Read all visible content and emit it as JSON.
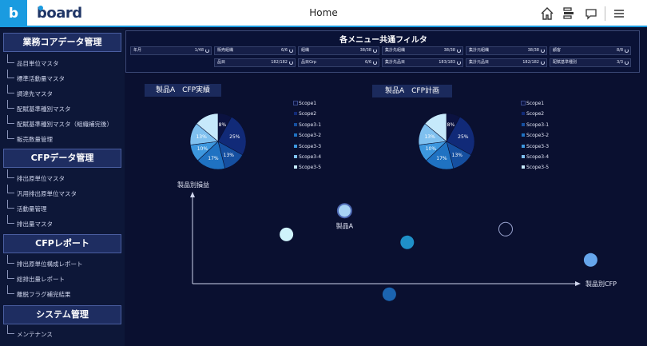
{
  "app": {
    "logo_letter": "b",
    "logo_text": "board",
    "page_title": "Home"
  },
  "toolbar": {
    "icons": [
      "home-icon",
      "layout-icon",
      "chat-icon",
      "menu-icon"
    ]
  },
  "sidebar": {
    "sections": [
      {
        "title": "業務コアデータ管理",
        "items": [
          "品目単位マスタ",
          "標準活動量マスタ",
          "調達先マスタ",
          "配賦基準種別マスタ",
          "配賦基準種別マスタ（組織補完後）",
          "販売数量管理"
        ]
      },
      {
        "title": "CFPデータ管理",
        "items": [
          "排出原単位マスタ",
          "汎用排出原単位マスタ",
          "活動量管理",
          "排出量マスタ"
        ]
      },
      {
        "title": "CFPレポート",
        "items": [
          "排出原単位構成レポート",
          "総排出量レポート",
          "離脱フラグ補完結果"
        ]
      },
      {
        "title": "システム管理",
        "items": [
          "メンテナンス"
        ]
      }
    ]
  },
  "filters": {
    "title": "各メニュー共通フィルタ",
    "rows": [
      [
        {
          "label": "年月",
          "count": "1/48"
        },
        {
          "label": "販売組織",
          "count": "6/6"
        },
        {
          "label": "組織",
          "count": "38/38"
        },
        {
          "label": "集計先組織",
          "count": "38/38"
        },
        {
          "label": "集計元組織",
          "count": "38/38"
        },
        {
          "label": "顧客",
          "count": "8/8"
        }
      ],
      [
        {
          "label": "",
          "count": ""
        },
        {
          "label": "品目",
          "count": "182/182"
        },
        {
          "label": "品目Grp",
          "count": "6/6"
        },
        {
          "label": "集計先品目",
          "count": "183/183"
        },
        {
          "label": "集計元品目",
          "count": "182/182"
        },
        {
          "label": "配賦基準種別",
          "count": "3/3"
        }
      ]
    ]
  },
  "charts": {
    "legend": [
      {
        "name": "Scope1",
        "color": "#0b1240"
      },
      {
        "name": "Scope2",
        "color": "#112a78"
      },
      {
        "name": "Scope3-1",
        "color": "#154fa0"
      },
      {
        "name": "Scope3-2",
        "color": "#1f72c2"
      },
      {
        "name": "Scope3-3",
        "color": "#3d97de"
      },
      {
        "name": "Scope3-4",
        "color": "#7fc0ef"
      },
      {
        "name": "Scope3-5",
        "color": "#c6e9fb"
      }
    ],
    "actual": {
      "title": "製品A　CFP実績",
      "slices": [
        8,
        25,
        13,
        17,
        10,
        13,
        14
      ],
      "labels": [
        "8%",
        "25%",
        "13%",
        "17%",
        "10%",
        "13%",
        ""
      ]
    },
    "plan": {
      "title": "製品A　CFP計画",
      "slices": [
        8,
        25,
        13,
        17,
        10,
        13,
        14
      ],
      "labels": [
        "8%",
        "25%",
        "13%",
        "17%",
        "10%",
        "13%",
        ""
      ]
    }
  },
  "chart_data": {
    "type": "scatter",
    "xlabel": "製品別CFP",
    "ylabel": "製品別損益",
    "series": [
      {
        "label": "製品A",
        "x": 0.34,
        "y": 0.83,
        "color": "#a8d4f4"
      },
      {
        "label": "",
        "x": 0.21,
        "y": 0.56,
        "color": "#cff3fb"
      },
      {
        "label": "",
        "x": 0.48,
        "y": 0.47,
        "color": "#1f90c8"
      },
      {
        "label": "",
        "x": 0.7,
        "y": 0.62,
        "color": "#0a1030"
      },
      {
        "label": "",
        "x": 0.89,
        "y": 0.27,
        "color": "#66a6ec"
      },
      {
        "label": "",
        "x": 0.44,
        "y": -0.12,
        "color": "#1b64b0"
      }
    ]
  }
}
